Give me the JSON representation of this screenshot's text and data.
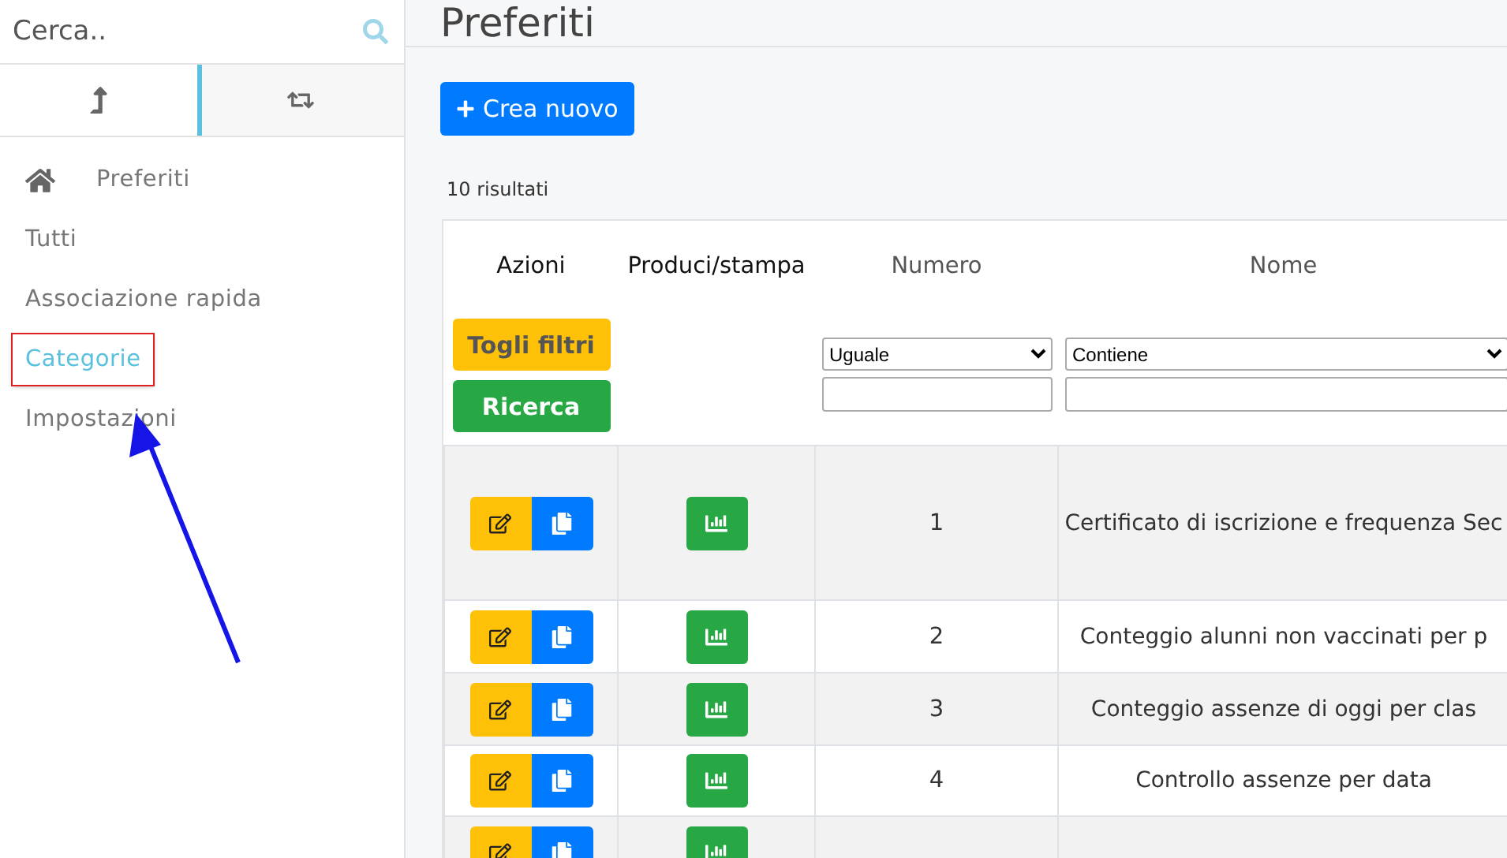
{
  "sidebar": {
    "search": {
      "placeholder": "Cerca.."
    },
    "tabs": [
      {
        "selected": true
      },
      {
        "selected": false
      }
    ],
    "items": [
      {
        "label": "Preferiti",
        "selected": false,
        "highlighted": false
      },
      {
        "label": "Tutti",
        "selected": false,
        "highlighted": false
      },
      {
        "label": "Associazione rapida",
        "selected": false,
        "highlighted": false
      },
      {
        "label": "Categorie",
        "selected": true,
        "highlighted": true
      },
      {
        "label": "Impostazioni",
        "selected": false,
        "highlighted": false
      }
    ]
  },
  "page": {
    "title": "Preferiti",
    "create_button": "Crea nuovo",
    "result_count": "10 risultati"
  },
  "table": {
    "columns": [
      {
        "label": "Azioni",
        "sortable": false
      },
      {
        "label": "Produci/stampa",
        "sortable": false
      },
      {
        "label": "Numero",
        "sortable": true
      },
      {
        "label": "Nome",
        "sortable": true
      }
    ],
    "clear_filters_button": "Togli filtri",
    "search_button": "Ricerca",
    "filters": {
      "numero": {
        "operator": "Uguale"
      },
      "nome": {
        "operator": "Contiene"
      }
    },
    "rows": [
      {
        "number": "1",
        "name": "Certificato di iscrizione e frequenza Sec"
      },
      {
        "number": "2",
        "name": "Conteggio alunni non vaccinati per p"
      },
      {
        "number": "3",
        "name": "Conteggio assenze di oggi per clas"
      },
      {
        "number": "4",
        "name": "Controllo assenze per data"
      },
      {}
    ]
  }
}
